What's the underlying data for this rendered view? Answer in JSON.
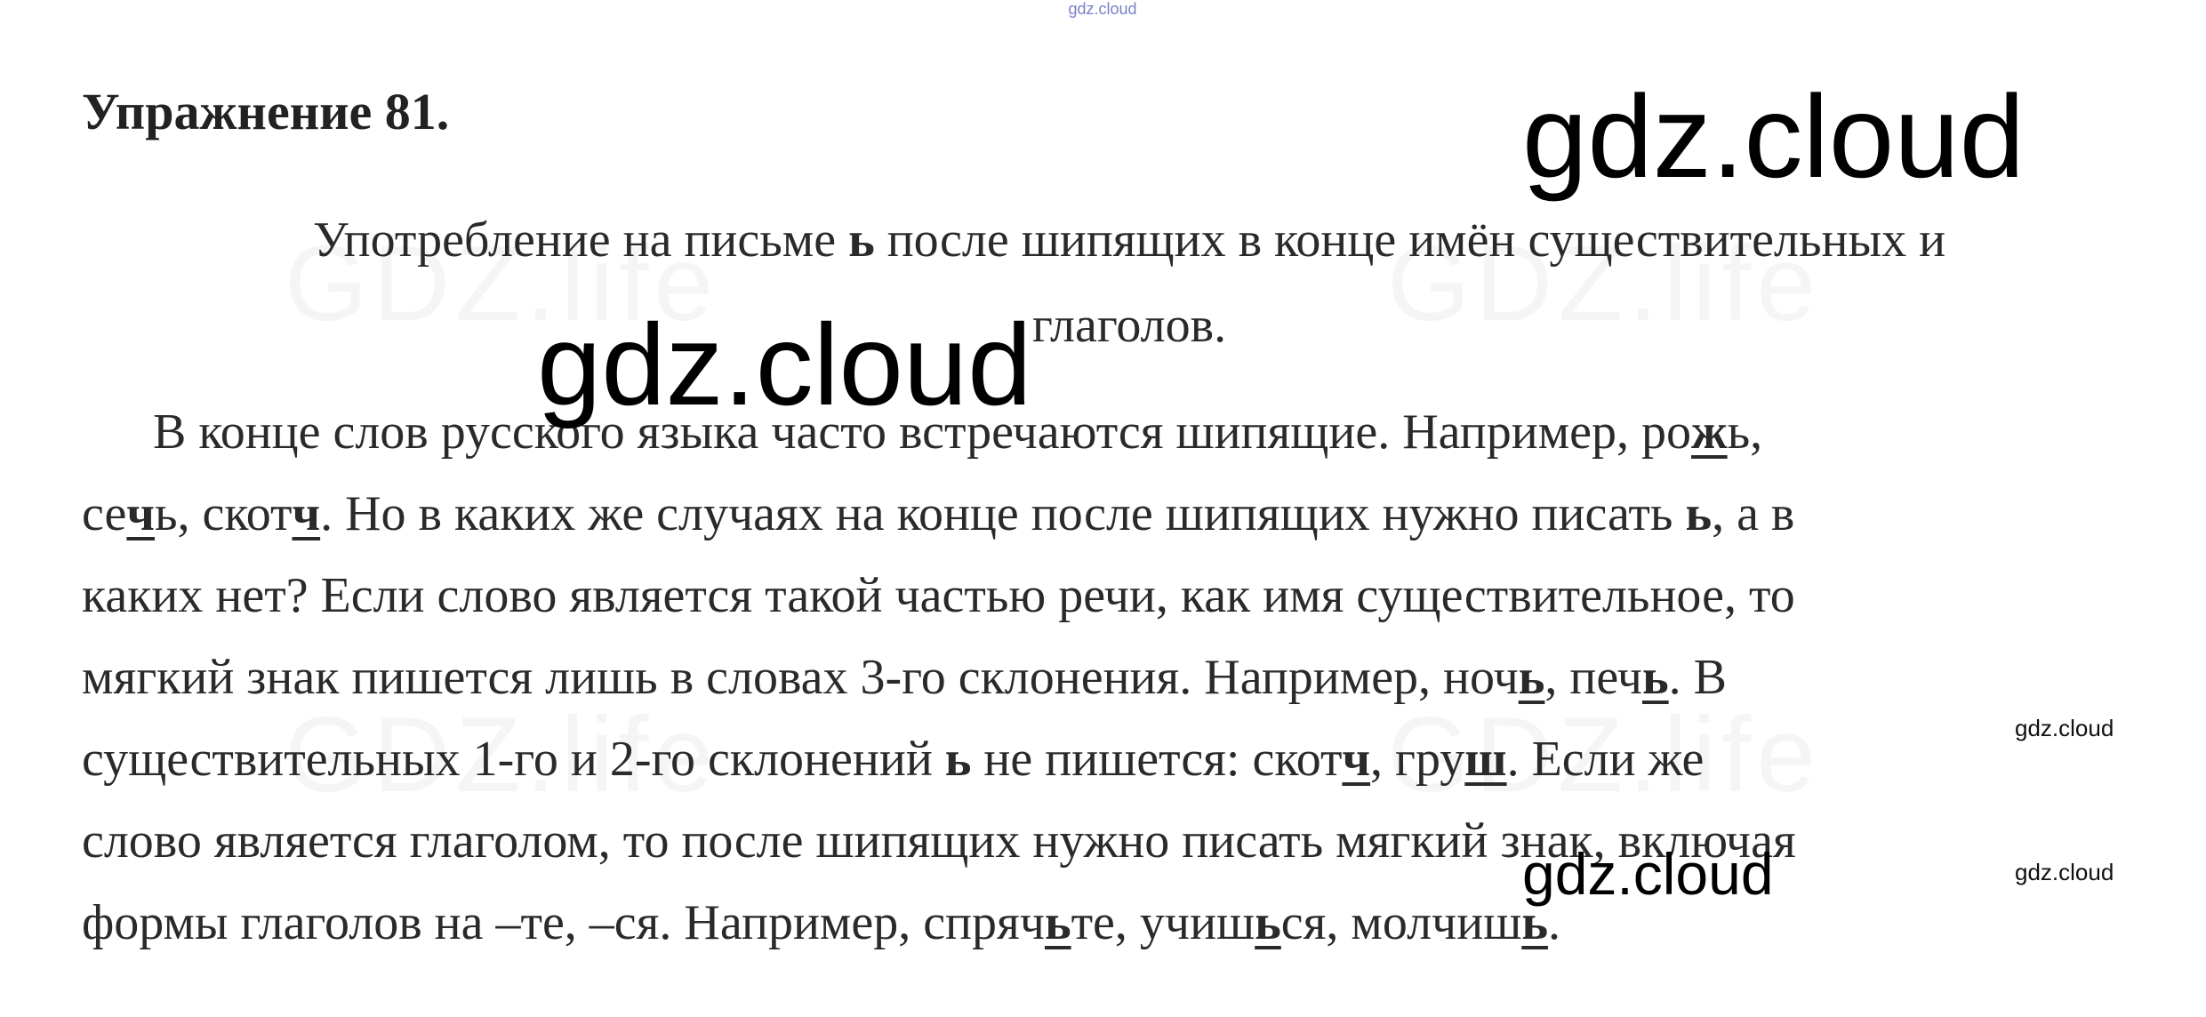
{
  "top_watermark": "gdz.cloud",
  "background_watermarks": [
    "GDZ.life",
    "GDZ.life",
    "GDZ.life",
    "GDZ.life"
  ],
  "heading": "Упражнение 81.",
  "subtitle": {
    "a": "Употребление на письме ",
    "soft_sign": "ь",
    "b": " после шипящих в конце имён существительных и",
    "c": "глаголов."
  },
  "paragraph": {
    "l1_a": "В конце слов русского языка часто встречаются шипящие. Например, ро",
    "l1_b": "ж",
    "l1_c": "ь,",
    "l2_a": "се",
    "l2_b": "ч",
    "l2_c": "ь, скот",
    "l2_d": "ч",
    "l2_e": ". Но в каких же случаях на конце после шипящих нужно писать ",
    "l2_f": "ь",
    "l2_g": ", а в",
    "l3": "каких нет? Если слово является такой частью речи, как имя существительное, то",
    "l4_a": "мягкий знак пишется лишь в словах 3-го склонения. Например, ноч",
    "l4_b": "ь",
    "l4_c": ", печ",
    "l4_d": "ь",
    "l4_e": ". В",
    "l5_a": "существительных 1-го и 2-го склонений ",
    "l5_b": "ь",
    "l5_c": " не пишется: скот",
    "l5_d": "ч",
    "l5_e": ", гру",
    "l5_f": "ш",
    "l5_g": ". Если же",
    "l6": "слово является глаголом, то после шипящих нужно писать мягкий знак, включая",
    "l7_a": "формы глаголов на –те, –ся. Например, спряч",
    "l7_b": "ь",
    "l7_c": "те, учиш",
    "l7_d": "ь",
    "l7_e": "ся, молчиш",
    "l7_f": "ь",
    "l7_g": "."
  },
  "watermarks": {
    "large_1": "gdz.cloud",
    "large_2": "gdz.cloud",
    "medium": "gdz.cloud",
    "small_1": "gdz.cloud",
    "small_2": "gdz.cloud"
  }
}
